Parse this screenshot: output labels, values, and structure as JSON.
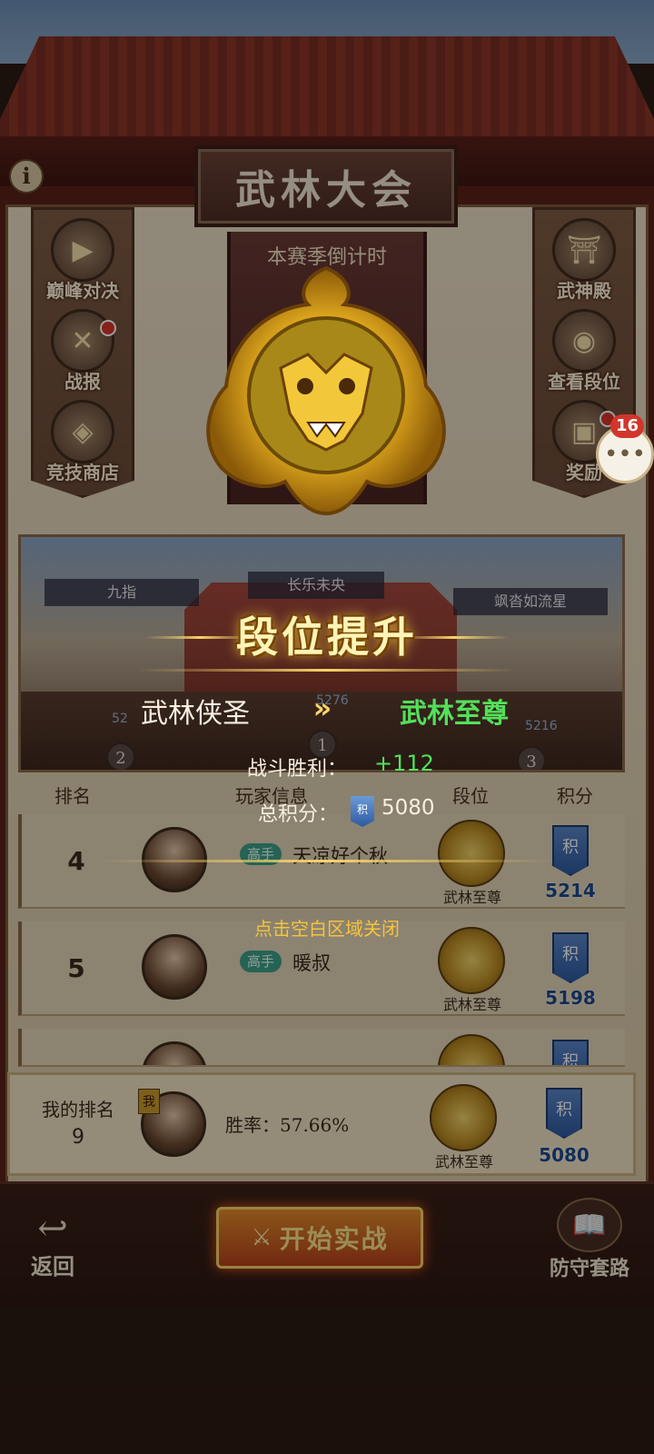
{
  "header": {
    "title": "武林大会",
    "season_countdown": "本赛季倒计时"
  },
  "left_menu": [
    {
      "label": "巅峰对决",
      "icon": "play-icon"
    },
    {
      "label": "战报",
      "icon": "scroll-icon"
    },
    {
      "label": "竞技商店",
      "icon": "shop-icon"
    }
  ],
  "right_menu": [
    {
      "label": "武神殿",
      "icon": "temple-icon"
    },
    {
      "label": "查看段位",
      "icon": "dragon-icon"
    },
    {
      "label": "奖励",
      "icon": "gift-icon"
    }
  ],
  "chat": {
    "badge_count": "16"
  },
  "stage": {
    "players": [
      {
        "name": "九指",
        "score": "52",
        "rank": "2"
      },
      {
        "name": "长乐未央",
        "score": "5276",
        "rank": "1"
      },
      {
        "name": "飒沓如流星",
        "score": "5216",
        "rank": "3"
      }
    ]
  },
  "table": {
    "headers": [
      "排名",
      "玩家信息",
      "段位",
      "积分"
    ],
    "rows": [
      {
        "rank": "4",
        "tag": "高手",
        "name": "天凉好个秋",
        "tier": "武林至尊",
        "score": "5214"
      },
      {
        "rank": "5",
        "tag": "高手",
        "name": "暖叔",
        "tier": "武林至尊",
        "score": "5198"
      },
      {
        "rank": "",
        "tag": "",
        "name": "",
        "tier": "",
        "score": ""
      }
    ],
    "score_chip_label": "积"
  },
  "my_rank": {
    "label": "我的排名",
    "rank": "9",
    "me_badge": "我",
    "win_rate": "胜率：57.66%",
    "tier": "武林至尊",
    "score": "5080"
  },
  "bottom": {
    "back_label": "返回",
    "start_label": "开始实战",
    "defense_label": "防守套路"
  },
  "promotion": {
    "title": "段位提升",
    "old_tier": "武林侠圣",
    "arrows": "»",
    "new_tier": "武林至尊",
    "battle_label": "战斗胜利：",
    "battle_gain": "+112",
    "total_label": "总积分：",
    "total_value": "5080",
    "close_hint": "点击空白区域关闭"
  },
  "colors": {
    "gain_green": "#54e05a",
    "gold": "#f7d36a",
    "hint_yellow": "#f5c43a"
  }
}
